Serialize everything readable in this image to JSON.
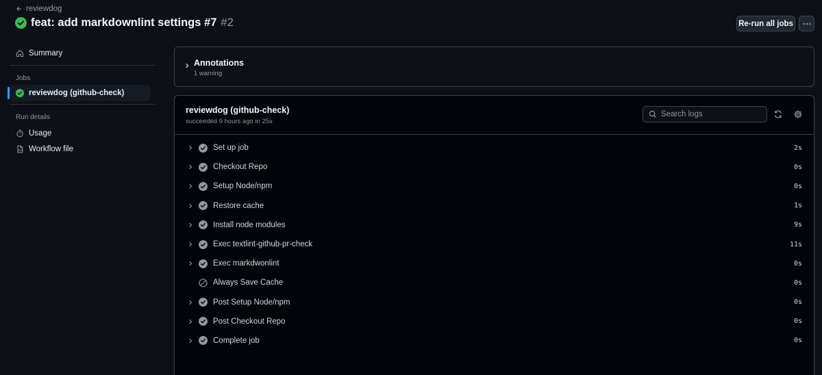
{
  "header": {
    "back_label": "reviewdog",
    "title": "feat: add markdownlint settings #7",
    "run_number": "#2",
    "rerun_label": "Re-run all jobs"
  },
  "sidebar": {
    "summary_label": "Summary",
    "jobs_heading": "Jobs",
    "jobs": [
      {
        "label": "reviewdog (github-check)",
        "status": "success"
      }
    ],
    "run_details_heading": "Run details",
    "details": [
      {
        "label": "Usage",
        "icon": "stopwatch-icon"
      },
      {
        "label": "Workflow file",
        "icon": "file-code-icon"
      }
    ]
  },
  "annotations": {
    "title": "Annotations",
    "subtitle": "1 warning"
  },
  "job": {
    "title": "reviewdog (github-check)",
    "subtitle": "succeeded 9 hours ago in 25s",
    "search_placeholder": "Search logs",
    "steps": [
      {
        "name": "Set up job",
        "duration": "2s",
        "status": "success"
      },
      {
        "name": "Checkout Repo",
        "duration": "0s",
        "status": "success"
      },
      {
        "name": "Setup Node/npm",
        "duration": "0s",
        "status": "success"
      },
      {
        "name": "Restore cache",
        "duration": "1s",
        "status": "success"
      },
      {
        "name": "Install node modules",
        "duration": "9s",
        "status": "success"
      },
      {
        "name": "Exec textlint-github-pr-check",
        "duration": "11s",
        "status": "success"
      },
      {
        "name": "Exec markdwonlint",
        "duration": "0s",
        "status": "success"
      },
      {
        "name": "Always Save Cache",
        "duration": "0s",
        "status": "skipped"
      },
      {
        "name": "Post Setup Node/npm",
        "duration": "0s",
        "status": "success"
      },
      {
        "name": "Post Checkout Repo",
        "duration": "0s",
        "status": "success"
      },
      {
        "name": "Complete job",
        "duration": "0s",
        "status": "success"
      }
    ]
  },
  "colors": {
    "background": "#0d1117",
    "success": "#3fb950",
    "accent": "#4493f8",
    "border": "#3d444d",
    "muted_text": "#9198a1"
  }
}
